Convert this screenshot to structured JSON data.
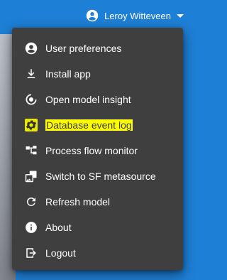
{
  "user": {
    "name": "Leroy Witteveen"
  },
  "menu": {
    "items": [
      {
        "label": "User preferences",
        "icon": "account-circle-icon"
      },
      {
        "label": "Install app",
        "icon": "download-icon"
      },
      {
        "label": "Open model insight",
        "icon": "insight-icon"
      },
      {
        "label": "Database event log",
        "icon": "gear-icon",
        "highlighted": true
      },
      {
        "label": "Process flow monitor",
        "icon": "process-flow-icon"
      },
      {
        "label": "Switch to SF metasource",
        "icon": "switch-source-icon"
      },
      {
        "label": "Refresh model",
        "icon": "refresh-icon"
      },
      {
        "label": "About",
        "icon": "info-icon"
      },
      {
        "label": "Logout",
        "icon": "logout-icon"
      }
    ]
  },
  "colors": {
    "header_bg": "#1e7fd6",
    "menu_bg": "#3f3f3f",
    "highlight": "#ffff00"
  }
}
